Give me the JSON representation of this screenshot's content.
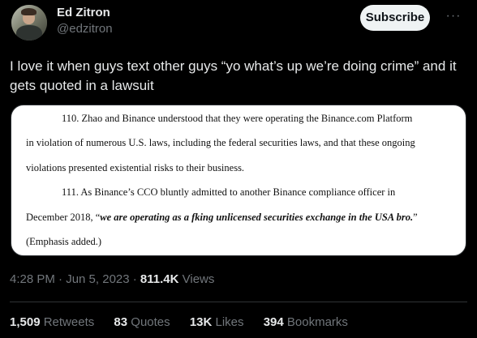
{
  "author": {
    "name": "Ed Zitron",
    "handle": "@edzitron"
  },
  "actions": {
    "subscribe_label": "Subscribe",
    "more_label": "···"
  },
  "tweet": {
    "text": "I love it when guys text other guys “yo what’s up we’re doing crime” and it gets quoted in a lawsuit"
  },
  "document": {
    "lines": [
      "110.     Zhao and Binance understood that they were operating the Binance.com Platform",
      "in violation of numerous U.S. laws, including the federal securities laws, and that these ongoing",
      "violations presented existential risks to their business.",
      "111.     As Binance’s CCO bluntly admitted to another Binance compliance officer in",
      "December 2018, “",
      "we are operating as a fking unlicensed securities exchange in the USA bro.",
      "”",
      "(Emphasis added.)"
    ]
  },
  "meta": {
    "timestamp": "4:28 PM · Jun 5, 2023 · ",
    "views_count": "811.4K",
    "views_label": " Views"
  },
  "stats": [
    {
      "count": "1,509",
      "label": " Retweets"
    },
    {
      "count": "83",
      "label": " Quotes"
    },
    {
      "count": "13K",
      "label": " Likes"
    },
    {
      "count": "394",
      "label": " Bookmarks"
    }
  ],
  "colors": {
    "background": "#000000",
    "text_primary": "#e7e9ea",
    "text_secondary": "#71767b",
    "subscribe_bg": "#eff3f4",
    "divider": "#2f3336"
  }
}
